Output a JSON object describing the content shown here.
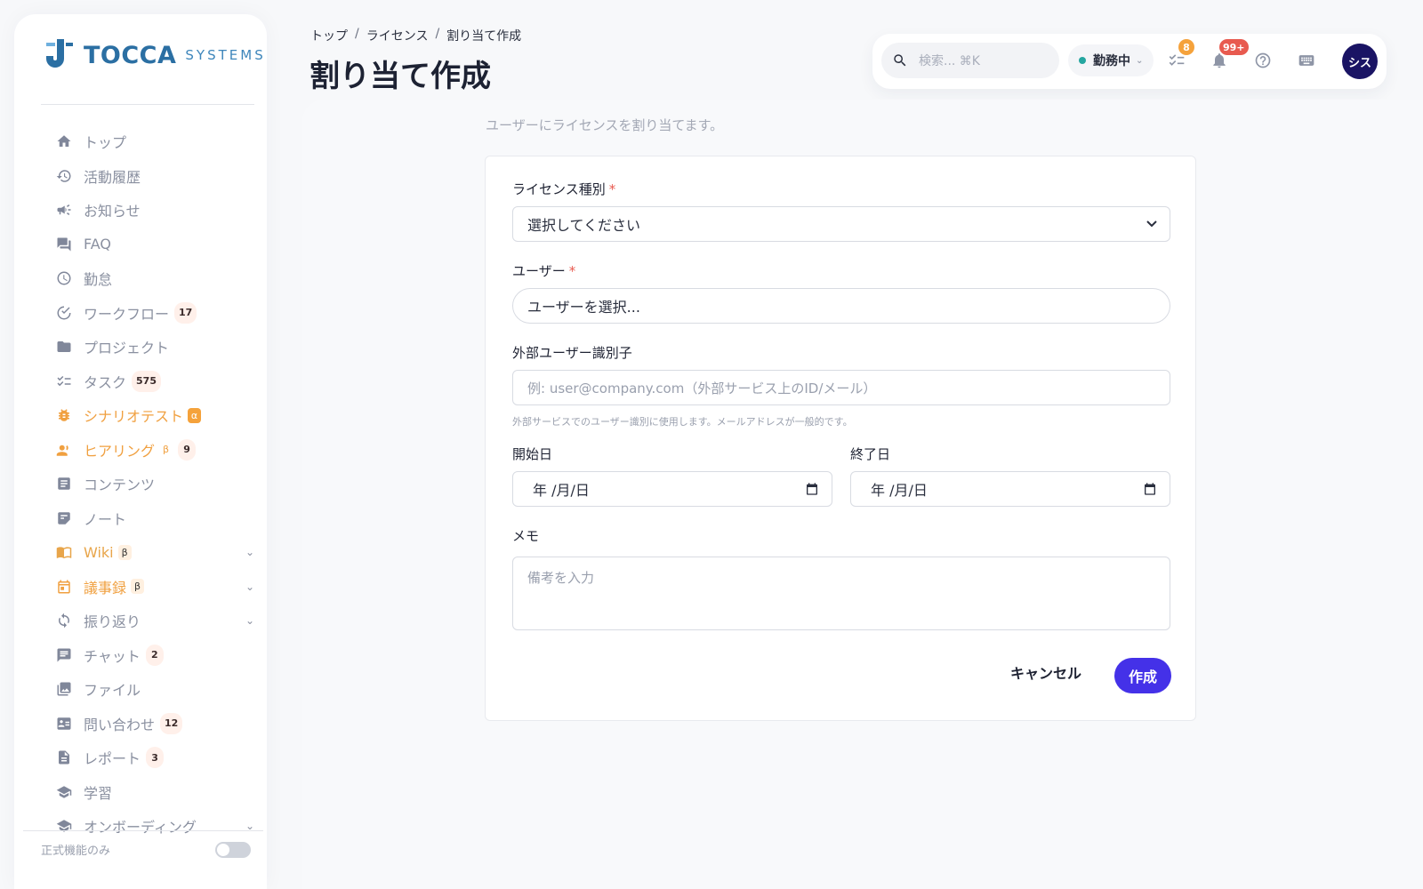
{
  "sidebar": {
    "logo": {
      "word": "TOCCA",
      "sub": "SYSTEMS"
    },
    "items": [
      {
        "label": "トップ",
        "icon": "home-icon"
      },
      {
        "label": "活動履歴",
        "icon": "history-icon"
      },
      {
        "label": "お知らせ",
        "icon": "megaphone-icon"
      },
      {
        "label": "FAQ",
        "icon": "forum-icon"
      },
      {
        "label": "勤怠",
        "icon": "clock-icon"
      },
      {
        "label": "ワークフロー",
        "icon": "check-circle-icon",
        "badge": "17"
      },
      {
        "label": "プロジェクト",
        "icon": "folder-icon"
      },
      {
        "label": "タスク",
        "icon": "checklist-icon",
        "badge": "575"
      },
      {
        "label": "シナリオテスト",
        "icon": "bug-icon",
        "tag": "α"
      },
      {
        "label": "ヒアリング",
        "icon": "people-speak-icon",
        "tag": "β",
        "badge": "9"
      },
      {
        "label": "コンテンツ",
        "icon": "article-icon"
      },
      {
        "label": "ノート",
        "icon": "note-icon"
      },
      {
        "label": "Wiki",
        "icon": "book-icon",
        "tag": "β"
      },
      {
        "label": "議事録",
        "icon": "calendar-icon",
        "tag": "β"
      },
      {
        "label": "振り返り",
        "icon": "sync-icon"
      },
      {
        "label": "チャット",
        "icon": "chat-icon",
        "badge": "2"
      },
      {
        "label": "ファイル",
        "icon": "photo-library-icon"
      },
      {
        "label": "問い合わせ",
        "icon": "contact-card-icon",
        "badge": "12"
      },
      {
        "label": "レポート",
        "icon": "document-icon",
        "badge": "3"
      },
      {
        "label": "学習",
        "icon": "school-icon"
      },
      {
        "label": "オンボーディング",
        "icon": "school-icon"
      }
    ],
    "footer_label": "正式機能のみ"
  },
  "breadcrumb": [
    "トップ",
    "ライセンス",
    "割り当て作成"
  ],
  "page_title": "割り当て作成",
  "topbar": {
    "search_placeholder": "検索... ⌘K",
    "status_label": "勤務中",
    "tasks_badge": "8",
    "notifications_badge": "99+",
    "avatar_text": "シス"
  },
  "colors": {
    "accent": "#4431e8",
    "status_green": "#25a6a0",
    "badge_orange": "#f5a23b",
    "badge_red": "#e85a4f"
  },
  "form": {
    "subtitle": "ユーザーにライセンスを割り当てます。",
    "license_type_label": "ライセンス種別",
    "license_type_value": "選択してください",
    "user_label": "ユーザー",
    "user_value": "ユーザーを選択...",
    "external_id_label": "外部ユーザー識別子",
    "external_id_placeholder": "例: user@company.com（外部サービス上のID/メール）",
    "external_id_help": "外部サービスでのユーザー識別に使用します。メールアドレスが一般的です。",
    "start_date_label": "開始日",
    "start_date_value": "年 /月/日",
    "end_date_label": "終了日",
    "end_date_value": "年 /月/日",
    "memo_label": "メモ",
    "memo_placeholder": "備考を入力",
    "cancel_label": "キャンセル",
    "create_label": "作成"
  }
}
